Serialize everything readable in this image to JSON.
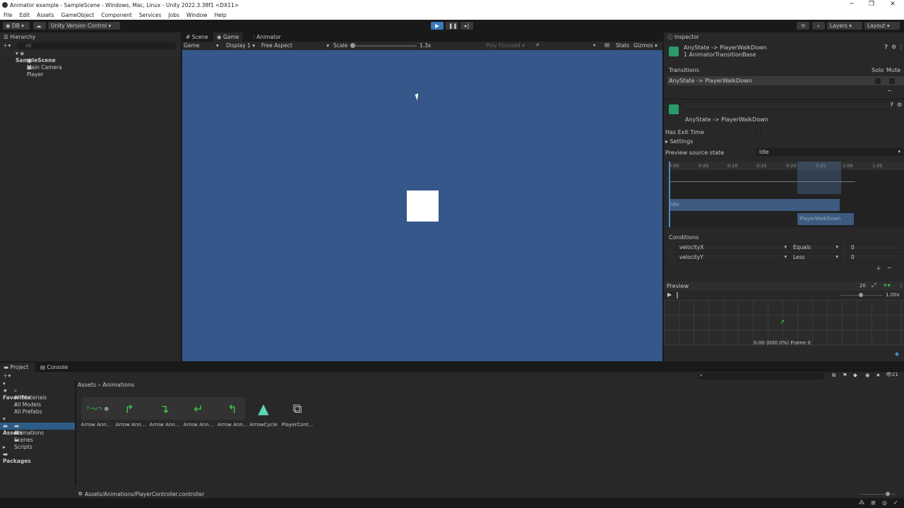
{
  "window": {
    "title": "Animator example - SampleScene - Windows, Mac, Linux - Unity 2022.3.38f1 <DX11>"
  },
  "menu": [
    "File",
    "Edit",
    "Assets",
    "GameObject",
    "Component",
    "Services",
    "Jobs",
    "Window",
    "Help"
  ],
  "toolbar": {
    "account": "DB",
    "version_control": "Unity Version Control",
    "layers": "Layers",
    "layout": "Layout"
  },
  "hierarchy": {
    "tab": "Hierarchy",
    "search_placeholder": "All",
    "scene": "SampleScene",
    "items": [
      "Main Camera",
      "Player"
    ]
  },
  "center": {
    "tabs": [
      "Scene",
      "Game",
      "Animator"
    ],
    "game_bar": {
      "mode": "Game",
      "display": "Display 1",
      "aspect": "Free Aspect",
      "scale_label": "Scale",
      "scale_value": "1.3x",
      "play_focused": "Play Focused",
      "stats": "Stats",
      "gizmos": "Gizmos"
    },
    "bg_color": "#35578a"
  },
  "inspector": {
    "tab": "Inspector",
    "title": "AnyState -> PlayerWalkDown",
    "subtitle": "1 AnimatorTransitionBase",
    "transitions_label": "Transitions",
    "solo": "Solo",
    "mute": "Mute",
    "transition_row": "AnyState -> PlayerWalkDown",
    "detail_title": "AnyState -> PlayerWalkDown",
    "has_exit_time": "Has Exit Time",
    "settings": "Settings",
    "preview_source_label": "Preview source state",
    "preview_source_value": "Idle",
    "timeline_ticks": [
      "0:00",
      "0:05",
      "0:10",
      "0:15",
      "0:20",
      "0:25",
      "1:00",
      "1:05"
    ],
    "state_idle": "Idle",
    "state_walk": "PlayerWalkDown",
    "conditions_label": "Conditions",
    "conditions": [
      {
        "param": "velocityX",
        "op": "Equals",
        "value": "0"
      },
      {
        "param": "velocityY",
        "op": "Less",
        "value": "0"
      }
    ],
    "preview_label": "Preview",
    "preview_fps": "20",
    "preview_speed": "1.00x",
    "preview_time": "0:00 (000.0%) Frame 0"
  },
  "project": {
    "tabs": [
      "Project",
      "Console"
    ],
    "favorites": "Favorites",
    "fav_items": [
      "All Materials",
      "All Models",
      "All Prefabs"
    ],
    "assets": "Assets",
    "asset_folders": [
      "Animations",
      "Scenes",
      "Scripts"
    ],
    "packages": "Packages",
    "breadcrumb": [
      "Assets",
      "Animations"
    ],
    "asset_count": "21",
    "files": [
      "Arrow Ann...",
      "Arrow Ann...",
      "Arrow Ann...",
      "Arrow Ann...",
      "Arrow Ann...",
      "ArrowCycle",
      "PlayerCont..."
    ],
    "status_path": "Assets/Animations/PlayerController.controller"
  },
  "colors": {
    "accent": "#2c5d87",
    "play_active": "#3a79bb",
    "green": "#3bd34a"
  }
}
